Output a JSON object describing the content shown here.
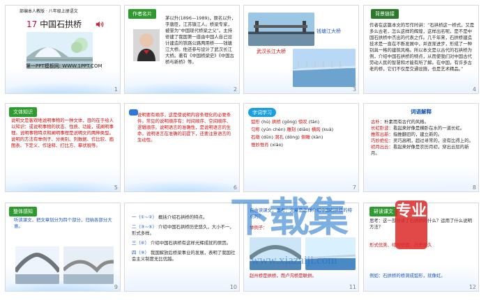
{
  "grid": {
    "slides": [
      {
        "num": "1"
      },
      {
        "num": "2"
      },
      {
        "num": "3"
      },
      {
        "num": "4"
      },
      {
        "num": "5"
      },
      {
        "num": "6"
      },
      {
        "num": "7"
      },
      {
        "num": "8"
      },
      {
        "num": "9"
      },
      {
        "num": "10"
      },
      {
        "num": "11"
      },
      {
        "num": "12"
      }
    ]
  },
  "s1": {
    "top": "部编本人教版 · 八年级上册语文",
    "title_num": "17",
    "title": "中国石拱桥",
    "footer": "第一PPT模板网: WWW.1PPT.COM"
  },
  "s2": {
    "tag": "作者名片",
    "body": "茅以升(1896—1989)，原名以升，字唐臣，江苏镇江人。桥梁专家，被誉为“中国现代桥梁之父”。主持修建了我国第一座由中国人自己设计建造的铁路公路两用桥——钱塘江大桥。他还参与设计了武汉长江大桥。著有《中国桥梁史》《中国古桥与新桥》等。"
  },
  "s3": {
    "label1": "钱塘江大桥",
    "label2": "武汉长江大桥"
  },
  "s4": {
    "tag": "背景链接",
    "body": "作者在这篇本文的写作时讲：“石拱桥这一桥式，又是多么古老，怎么这样的辉煌，这样出名呢，是不是中国石拱桥中杰出的代表之作。几千年来，石拱桥建造技术是一直在不断发展中，并逐渐进步，形成了一种别具一格的建筑风格。所以本文是以古代的石拱桥为例，介绍中国石拱桥的特点，从而使我们对中国古代劳动人民的智慧和才能有所了解。在中国，有许多古老的桥，它们不仅是交通设施，也是艺术精品。”"
  },
  "s5": {
    "tag": "文体知识",
    "body": "说明文是客观地说明事物的一种文体，目的在于给人以知识：或说明事物的状态、性质、功能，或阐明事理。说明事物特点和阐明事理是说明文的两种类型。说明的方法有举例子、分类别、列数据、作比较、画图表、下定义、作诠释、打比方、摹状貌等。"
  },
  "s6": {
    "body": "说明要有顺序，这是使说明内容条理化的必要条件。常见的说明顺序有：时间顺序、空间顺序、逻辑顺序。说明语言的准确性，是说明语言的生命，说明语言在准确的前提下，还要注意语言的生动性。"
  },
  "s7": {
    "tag": "字词学习",
    "words": [
      [
        "弧形",
        "hú"
      ],
      [
        "拱桥",
        "gǒng"
      ],
      [
        "惊叹",
        "tàn"
      ],
      [
        "匀称",
        "yún chèn"
      ],
      [
        "雕刻",
        "diāo"
      ],
      [
        "横跨",
        "kuà"
      ],
      [
        "石墩",
        "dūn"
      ],
      [
        "洞孔",
        "dòng"
      ],
      [
        "俯瞰",
        "kàn"
      ],
      [
        "惟妙惟肖",
        "xiào"
      ]
    ]
  },
  "s8": {
    "title": "词语解释",
    "items": [
      [
        "古朴：",
        "朴素而有古代的风格。"
      ],
      [
        "长虹卧波：",
        "看起来好像是横卧在水的一道长虹。"
      ],
      [
        "推陈出新：",
        "指推翻旧的，建立新的。"
      ],
      [
        "巧妙绝伦：",
        "灵巧高明，超过寻常的，没有比得上的。"
      ],
      [
        "初月出云：",
        "看起来好像是农历月初，穿出云层的新月。"
      ]
    ]
  },
  "s9": {
    "tag": "整体感知",
    "body": "听读课文，把文章划分为四个部分，归纳各部分大意。"
  },
  "s10": {
    "items": [
      [
        "一（①~②）",
        "概括介绍石拱桥的特点。"
      ],
      [
        "二（③~⑤）",
        "介绍中国石拱桥历史悠久，大小不一，形式多样。"
      ],
      [
        "三（⑥）",
        "介绍中国石拱桥有这样光辉成就的原因。"
      ],
      [
        "四（⑨）",
        "我国解放后桥梁事业的发展，表明了我国社会主义制度无比优越。"
      ]
    ]
  },
  "s11": {
    "line1": "自由读课文，思考：文章是怎样介绍中国石拱桥的特点的？",
    "tag": "举例子：",
    "caption": "赵州桥是拱桥，而卢沟桥是联拱。"
  },
  "s12": {
    "tag": "研读课文",
    "body1": "思考：这一部分讲了石拱桥的什么？运用了什么说明方法？",
    "body2": "形式优美、结构坚固、历史悠久",
    "body3": "例如：石拱桥的桥洞成弧形，就像虹。"
  },
  "watermark": {
    "big": "下载集",
    "seal": "专业",
    "url": "www.xiazaiji.com"
  },
  "icons": [
    "speaker-icon",
    "leaf-icon"
  ],
  "colors": {
    "red": "#d10f0f",
    "blue": "#1d56c6",
    "green_tag": "#2f9a2f",
    "pill": "#1aa0e0"
  }
}
